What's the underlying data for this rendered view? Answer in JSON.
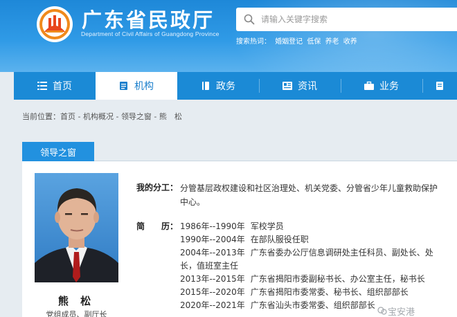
{
  "header": {
    "title": "广东省民政厅",
    "subtitle": "Department of Civil Affairs of Guangdong Province",
    "search": {
      "placeholder": "请输入关键字搜索"
    },
    "hot_label": "搜索热词：",
    "hot_words": [
      "婚姻登记",
      "低保",
      "养老",
      "收养"
    ],
    "brand_color": "#1e88d8"
  },
  "nav": {
    "items": [
      {
        "label": "首页",
        "icon": "list-icon"
      },
      {
        "label": "机构",
        "icon": "document-icon",
        "active": true
      },
      {
        "label": "政务",
        "icon": "book-icon"
      },
      {
        "label": "资讯",
        "icon": "newspaper-icon"
      },
      {
        "label": "业务",
        "icon": "briefcase-icon"
      }
    ]
  },
  "breadcrumb": {
    "prefix": "当前位置：",
    "items": [
      "首页",
      "机构概况",
      "领导之窗",
      "熊　松"
    ],
    "separator": " - "
  },
  "section": {
    "title": "领导之窗"
  },
  "profile": {
    "name": "熊 松",
    "role": "党组成员、副厅长",
    "duty_label": "我的分工：",
    "duty_text": "分管基层政权建设和社区治理处、机关党委、分管省少年儿童救助保护中心。",
    "resume_label": "简　　历：",
    "resume": [
      {
        "period": "1986年--1990年",
        "desc": "军校学员"
      },
      {
        "period": "1990年--2004年",
        "desc": "在部队服役任职"
      },
      {
        "period": "2004年--2013年",
        "desc": "广东省委办公厅信息调研处主任科员、副处长、处"
      },
      {
        "period": "",
        "desc": "长，值班室主任"
      },
      {
        "period": "2013年--2015年",
        "desc": "广东省揭阳市委副秘书长、办公室主任，秘书长"
      },
      {
        "period": "2015年--2020年",
        "desc": "广东省揭阳市委常委、秘书长、组织部部长"
      },
      {
        "period": "2020年--2021年",
        "desc": "广东省汕头市委常委、组织部部长"
      }
    ]
  },
  "watermark": "宝安港"
}
